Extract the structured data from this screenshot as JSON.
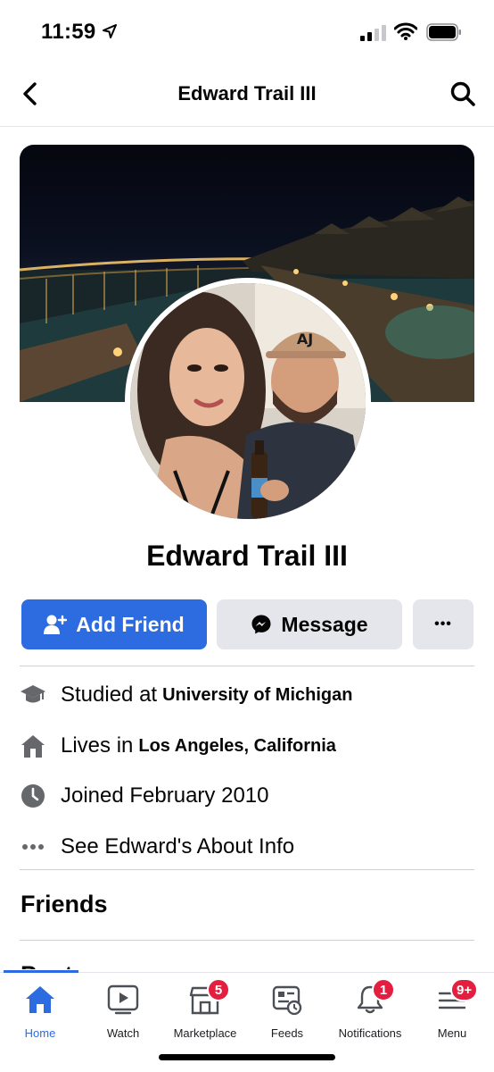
{
  "status_bar": {
    "time": "11:59"
  },
  "header": {
    "title": "Edward Trail III"
  },
  "profile": {
    "name": "Edward Trail III",
    "add_friend_label": "Add Friend",
    "message_label": "Message",
    "more_label": "•••"
  },
  "details": [
    {
      "prefix": "Studied at",
      "value": "University of Michigan",
      "icon": "graduation-cap-icon"
    },
    {
      "prefix": "Lives in",
      "value": "Los Angeles, California",
      "icon": "home-icon"
    },
    {
      "prefix": "Joined February 2010",
      "value": "",
      "icon": "clock-icon"
    },
    {
      "prefix": "See Edward's About Info",
      "value": "",
      "icon": "more-dots-icon"
    }
  ],
  "sections": {
    "friends": "Friends",
    "posts": "Posts"
  },
  "tabbar": {
    "items": [
      {
        "label": "Home",
        "badge": ""
      },
      {
        "label": "Watch",
        "badge": ""
      },
      {
        "label": "Marketplace",
        "badge": "5"
      },
      {
        "label": "Feeds",
        "badge": ""
      },
      {
        "label": "Notifications",
        "badge": "1"
      },
      {
        "label": "Menu",
        "badge": "9+"
      }
    ]
  },
  "colors": {
    "accent": "#2d6ce0",
    "badge": "#e41e3f",
    "button_gray": "#e4e6eb"
  }
}
